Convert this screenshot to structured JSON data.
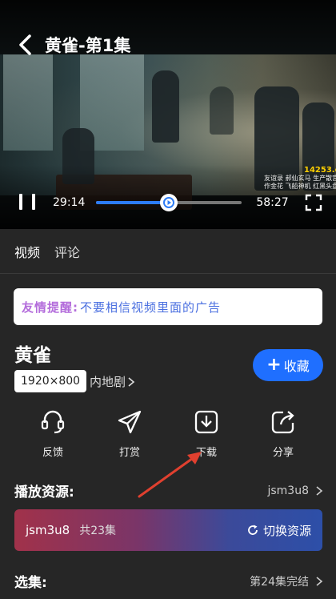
{
  "header": {
    "back_icon": "chevron-left-icon",
    "title": "黄雀-第1集"
  },
  "player": {
    "watermark_site": "14253.com",
    "watermark_lines": [
      "友谊录  郝仙玄马  生产散宫",
      "作金花  飞船神机  红黑头盘"
    ],
    "current_time": "29:14",
    "duration": "58:27",
    "progress": 0.5,
    "pause_icon": "pause-icon",
    "fullscreen_icon": "fullscreen-icon"
  },
  "tabs": [
    {
      "label": "视频"
    },
    {
      "label": "评论"
    }
  ],
  "notice": {
    "label": "友情提醒:",
    "text": "不要相信视频里面的广告"
  },
  "info": {
    "title": "黄雀",
    "resolution": "1920×800",
    "region": "内地剧",
    "favorite_label": "收藏",
    "favorite_color": "#1f6fff"
  },
  "actions": [
    {
      "label": "反馈",
      "icon": "headset-icon"
    },
    {
      "label": "打赏",
      "icon": "paper-plane-icon"
    },
    {
      "label": "下载",
      "icon": "download-icon"
    },
    {
      "label": "分享",
      "icon": "share-icon"
    }
  ],
  "sources": {
    "title": "播放资源:",
    "selected": "jsm3u8",
    "card_name": "jsm3u8",
    "card_count": "共23集",
    "switch_label": "切换资源"
  },
  "episodes": {
    "title": "选集:",
    "status": "第24集完结"
  },
  "colors": {
    "accent": "#1f6fff",
    "notice_label": "#b36cdb",
    "notice_text": "#4a6fe0",
    "annotation_arrow": "#e0402f"
  }
}
